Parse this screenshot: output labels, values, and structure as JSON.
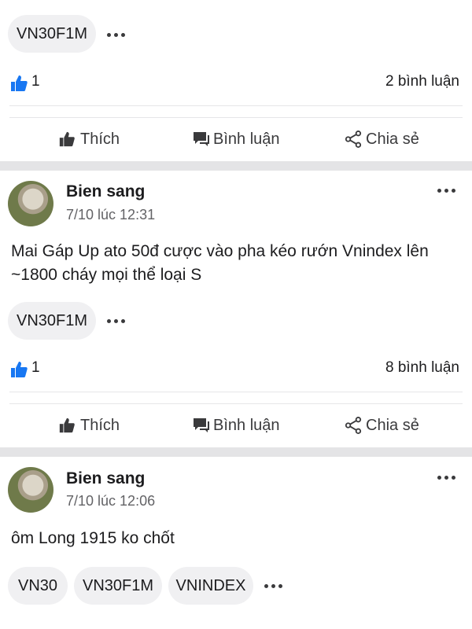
{
  "colors": {
    "accent": "#1877f2",
    "separator": "#e4e4e6",
    "tag_bg": "#f0f0f2"
  },
  "actions": {
    "like": "Thích",
    "comment": "Bình luận",
    "share": "Chia sẻ"
  },
  "top_post": {
    "tags": [
      "VN30F1M"
    ],
    "likes": "1",
    "comments": "2 bình luận"
  },
  "posts": [
    {
      "author": "Bien sang",
      "time": "7/10 lúc 12:31",
      "text_line1": "Mai Gáp Up ato 50đ cược vào pha kéo rướn Vnindex lên",
      "text_line2": "~1800 cháy mọi thể loại S",
      "tags": [
        "VN30F1M"
      ],
      "likes": "1",
      "comments": "8 bình luận"
    },
    {
      "author": "Bien sang",
      "time": "7/10 lúc 12:06",
      "text_line1": "ôm Long 1915 ko chốt",
      "tags": [
        "VN30",
        "VN30F1M",
        "VNINDEX"
      ]
    }
  ]
}
